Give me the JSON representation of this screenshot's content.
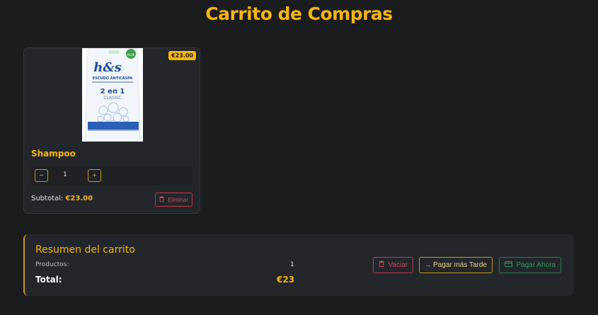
{
  "page": {
    "title": "Carrito de Compras"
  },
  "cart_items": [
    {
      "name": "Shampoo",
      "price_badge": "€23.00",
      "quantity": "1",
      "subtotal_label": "Subtotal:",
      "subtotal_value": "€23.00",
      "decrement_label": "−",
      "increment_label": "+",
      "delete_label": "Eliminar",
      "image": {
        "brand": "h&s",
        "line1": "ESCUDO ANTICASPA",
        "line2": "2 en 1",
        "line3": "CLASSIC",
        "badge": "ALOE"
      }
    }
  ],
  "summary": {
    "title": "Resumen del carrito",
    "products_label": "Productos:",
    "products_value": "1",
    "total_label": "Total:",
    "total_value": "€23",
    "empty_label": "Vaciar",
    "pay_later_label": "Pagar más Tarde",
    "pay_now_label": "Pagar Ahora"
  },
  "colors": {
    "background": "#1b1c1e",
    "accent": "#f5b50f",
    "danger": "#d9485a",
    "success": "#2f9b60"
  }
}
